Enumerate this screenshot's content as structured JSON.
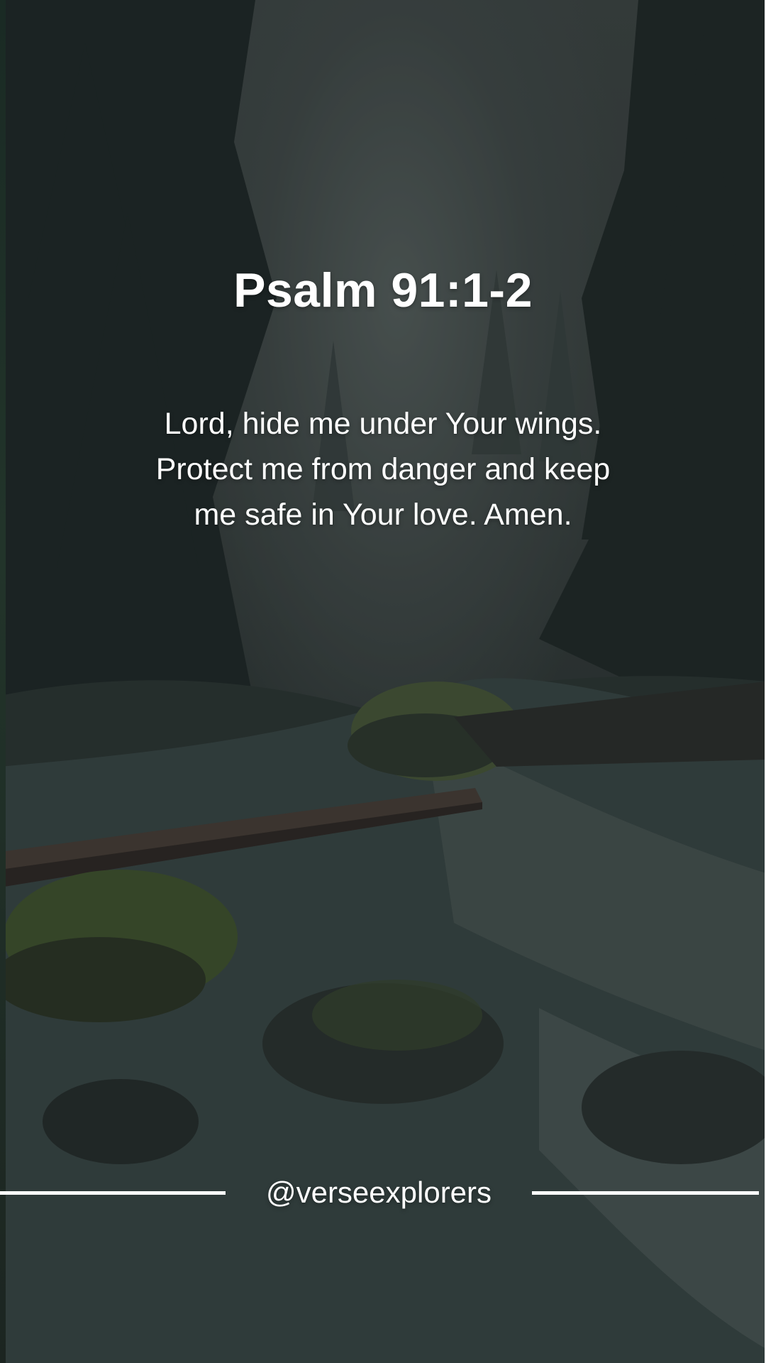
{
  "post": {
    "title": "Psalm 91:1-2",
    "prayer": "Lord, hide me under Your wings. Protect me from danger and keep me safe in Your love. Amen.",
    "handle": "@verseexplorers"
  },
  "background": {
    "scene": "misty forest river photo",
    "colors": {
      "sky": "#4a5352",
      "forest": "#2a3532",
      "water": "#3c4a49",
      "moss": "#4d6a3a",
      "text": "#ffffff"
    }
  }
}
